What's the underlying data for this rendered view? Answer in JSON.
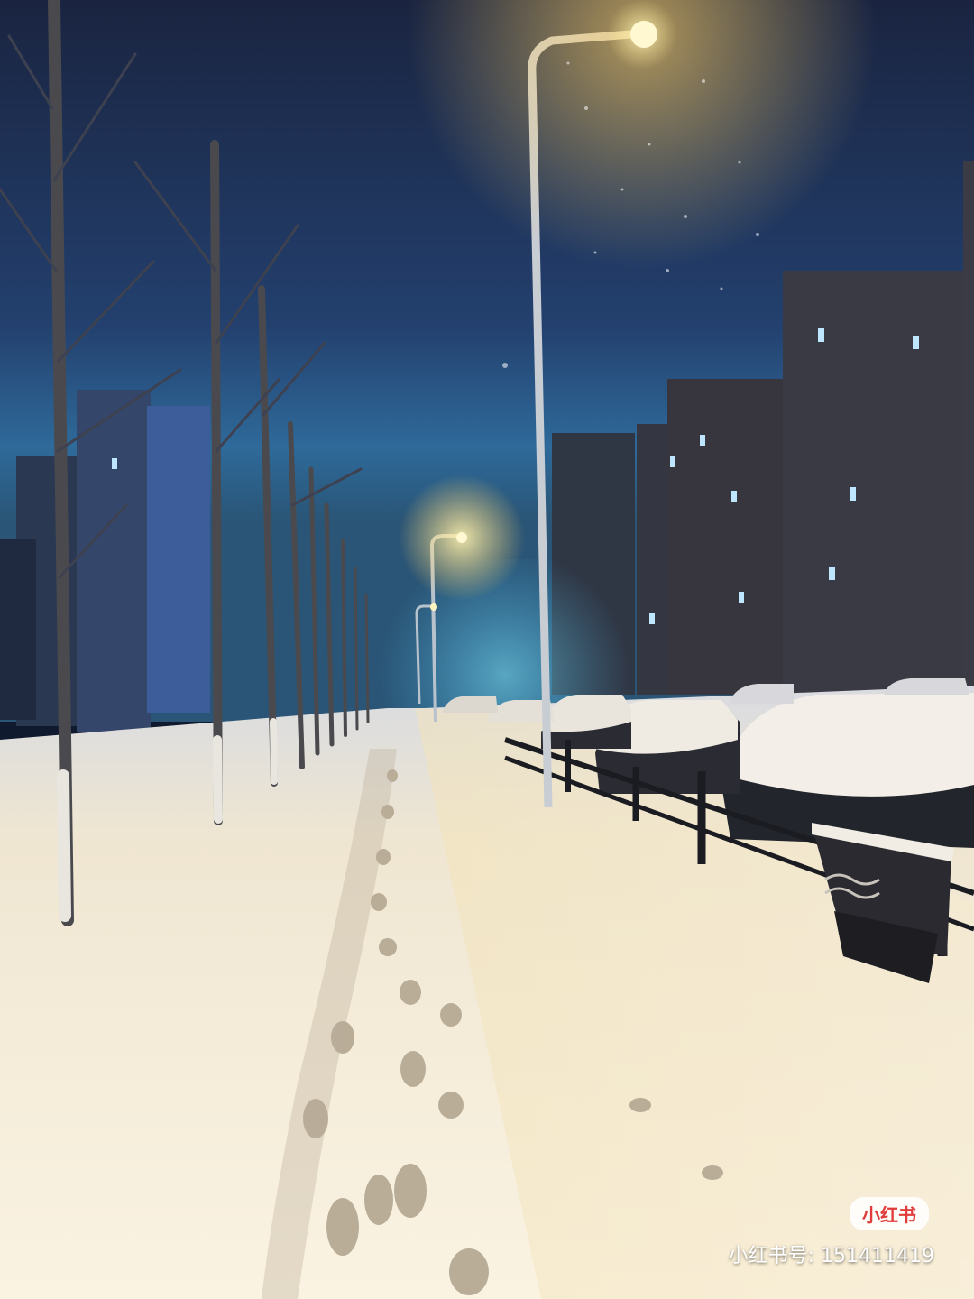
{
  "watermark": {
    "brand_label": "小红书",
    "id_label": "小红书号: 151411419"
  },
  "scene": {
    "sky_color": "#213a66",
    "lamp_glow_color": "#ffd166",
    "snow_color": "#fbf3e2",
    "building_color": "#3a3a44"
  }
}
